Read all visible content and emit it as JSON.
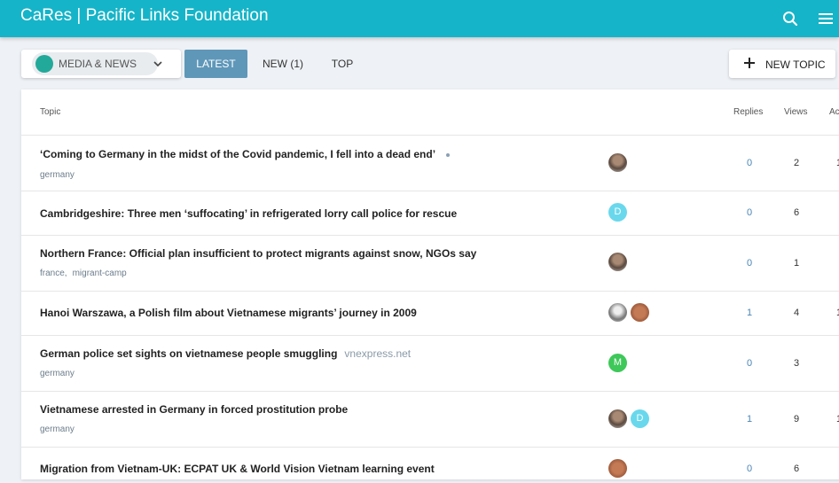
{
  "header": {
    "title": "CaRes | Pacific Links Foundation"
  },
  "nav": {
    "category": "MEDIA & NEWS",
    "tabs": {
      "latest": "LATEST",
      "new": "NEW (1)",
      "top": "TOP"
    },
    "new_topic": "NEW TOPIC"
  },
  "table": {
    "headers": {
      "topic": "Topic",
      "replies": "Replies",
      "views": "Views",
      "activity": "Ac"
    },
    "rows": [
      {
        "title": "‘Coming to Germany in the midst of the Covid pandemic, I fell into a dead end’",
        "tags": [
          "germany"
        ],
        "replies": "0",
        "views": "2",
        "activity": "1"
      },
      {
        "title": "Cambridgeshire: Three men ‘suffocating’ in refrigerated lorry call police for rescue",
        "tags": [],
        "replies": "0",
        "views": "6",
        "activity": "",
        "avatar_letter": "D"
      },
      {
        "title": "Northern France: Official plan insufficient to protect migrants against snow, NGOs say",
        "tags": [
          "france,",
          "migrant-camp"
        ],
        "replies": "0",
        "views": "1",
        "activity": ""
      },
      {
        "title": "Hanoi Warszawa, a Polish film about Vietnamese migrants’ journey in 2009",
        "tags": [],
        "replies": "1",
        "views": "4",
        "activity": "1"
      },
      {
        "title": "German police set sights on vietnamese people smuggling",
        "domain": "vnexpress.net",
        "tags": [
          "germany"
        ],
        "replies": "0",
        "views": "3",
        "activity": "",
        "avatar_letter": "M"
      },
      {
        "title": "Vietnamese arrested in Germany in forced prostitution probe",
        "tags": [
          "germany"
        ],
        "replies": "1",
        "views": "9",
        "activity": "1",
        "avatar_letter": "D"
      },
      {
        "title": "Migration from Vietnam-UK: ECPAT UK & World Vision Vietnam learning event",
        "tags": [],
        "replies": "0",
        "views": "6",
        "activity": ""
      }
    ]
  },
  "colors": {
    "header_bg": "#16b4c8",
    "active_tab": "#5f97b9",
    "category_dot": "#22a999",
    "avatar_d": "#6ad8ec",
    "avatar_m": "#3ec85a"
  }
}
